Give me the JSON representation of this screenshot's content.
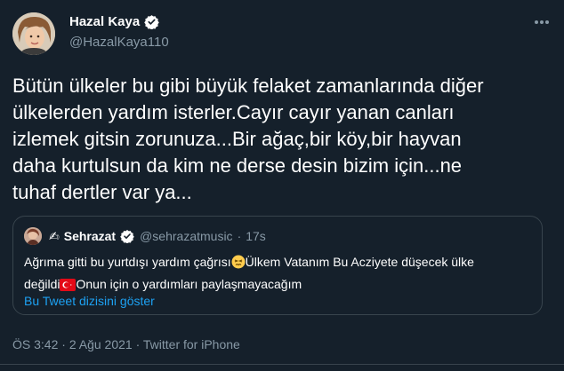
{
  "author": {
    "name": "Hazal Kaya",
    "handle": "@HazalKaya110",
    "verified": true
  },
  "tweet": {
    "lines": [
      "Bütün ülkeler bu gibi büyük felaket zamanlarında diğer",
      "ülkelerden yardım isterler.Cayır cayır yanan canları",
      "izlemek gitsin zorunuza...Bir ağaç,bir köy,bir hayvan",
      "daha kurtulsun da kim ne derse desin bizim için...ne",
      "tuhaf dertler var ya..."
    ]
  },
  "quote": {
    "name": "Sehrazat",
    "name_prefix_emoji": "✍",
    "handle": "@sehrazatmusic",
    "separator": "·",
    "time": "17s",
    "line1_before_emoji": "Ağrıma gitti bu yurtdışı yardım çağrısı",
    "line1_emoji": "😣",
    "line1_after_emoji": "Ülkem Vatanım Bu Acziyete düşecek ülke",
    "line2_before_flag": "değildi",
    "flag_emoji": "🇹🇷",
    "line2_after_flag": "Onun için o yardımları paylaşmayacağım",
    "show_thread": "Bu Tweet dizisini göster"
  },
  "meta": {
    "time": "ÖS 3:42",
    "dot1": "·",
    "date": "2 Ağu 2021",
    "dot2": "·",
    "source": "Twitter for iPhone"
  },
  "colors": {
    "background": "#15202b",
    "text": "#ffffff",
    "secondary": "#8899a6",
    "link": "#1da1f2",
    "border": "#38444d",
    "verified": "#ffffff"
  },
  "icons": {
    "verified": "verified-badge-icon",
    "more": "more-dots-icon",
    "flag": "turkey-flag-icon",
    "emoji": "persevering-face-icon"
  }
}
